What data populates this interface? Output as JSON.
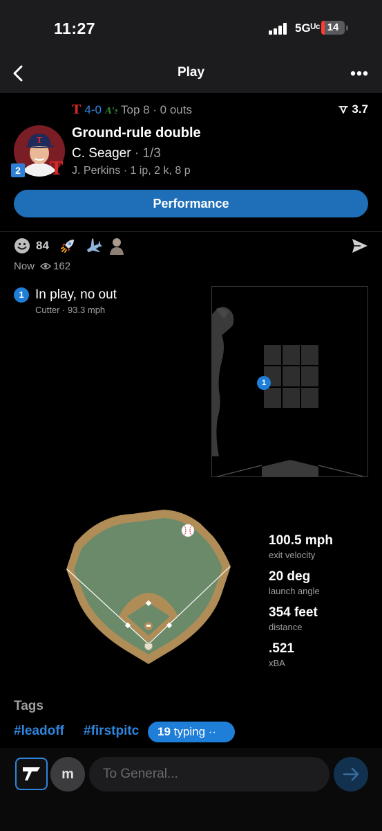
{
  "status_bar": {
    "time": "11:27",
    "network": "5Gᵁᶜ",
    "battery": "14",
    "battery_level": 0.14
  },
  "nav": {
    "title": "Play",
    "back_icon": "chevron-left-icon",
    "more_icon": "ellipsis-icon"
  },
  "game": {
    "home_team_logo": "T",
    "score": "4-0",
    "inning": "Top 8 · 0 outs",
    "win_prob": "3.7"
  },
  "play": {
    "title": "Ground-rule double",
    "batter": "C. Seager",
    "batter_line": "· 1/3",
    "pitcher": "J. Perkins · 1 ip, 2 k, 8 p",
    "jersey_badge": "2",
    "team_logo": "T"
  },
  "performance_button": "Performance",
  "reactions": {
    "smile_count": "84",
    "icons": [
      "smile-icon",
      "rocket-icon",
      "airplane-icon",
      "person-emoji-icon"
    ]
  },
  "meta": {
    "time": "Now",
    "views": "162"
  },
  "pitch": {
    "number": "1",
    "result": "In play, no out",
    "detail": "Cutter ·  93.3 mph"
  },
  "batted_ball": {
    "stats": [
      {
        "value": "100.5 mph",
        "label": "exit velocity"
      },
      {
        "value": "20 deg",
        "label": "launch angle"
      },
      {
        "value": "354 feet",
        "label": "distance"
      },
      {
        "value": ".521",
        "label": "xBA"
      }
    ]
  },
  "tags": {
    "title": "Tags",
    "items": [
      "#leadoff",
      "#firstpitc"
    ]
  },
  "typing": {
    "count": "19",
    "label": "typing ··"
  },
  "compose": {
    "user_initial": "m",
    "placeholder": "To General..."
  },
  "colors": {
    "accent": "#1f6fb8",
    "link": "#2f86e0",
    "field_grass": "#6b8a6a",
    "field_dirt": "#b08d57"
  }
}
